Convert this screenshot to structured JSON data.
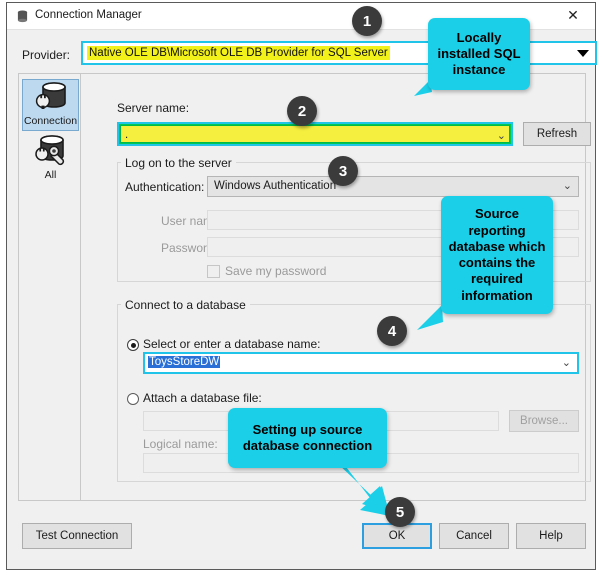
{
  "window": {
    "title": "Connection Manager",
    "close_label": "✕",
    "icon": "database-icon"
  },
  "provider": {
    "label": "Provider:",
    "value": "Native OLE DB\\Microsoft OLE DB Provider for SQL Server",
    "highlight_color": "#f3f11a",
    "focus_color": "#1fc4e8"
  },
  "sidebar": {
    "items": [
      {
        "label": "Connection",
        "icon": "database-plug-icon",
        "selected": true
      },
      {
        "label": "All",
        "icon": "database-wrench-icon",
        "selected": false
      }
    ]
  },
  "server": {
    "label": "Server name:",
    "value": ".",
    "chevron": "⌄",
    "refresh_label": "Refresh",
    "fill_color": "#f5ef3f",
    "inner_border_color": "#00b84a",
    "outer_border_color": "#1fc4e8"
  },
  "logon": {
    "group_title": "Log on to the server",
    "auth_label": "Authentication:",
    "auth_value": "Windows Authentication",
    "auth_chevron": "⌄",
    "username_label": "User name:",
    "username_value": "",
    "password_label": "Password:",
    "password_value": "",
    "save_password_label": "Save my password",
    "save_password_checked": false
  },
  "database": {
    "group_title": "Connect to a database",
    "select_radio_label": "Select or enter a database name:",
    "select_radio_checked": true,
    "selected_db": "ToysStoreDW",
    "db_chevron": "⌄",
    "attach_radio_label": "Attach a database file:",
    "attach_radio_checked": false,
    "attach_file_value": "",
    "browse_label": "Browse...",
    "logical_name_label": "Logical name:",
    "logical_name_value": ""
  },
  "footer": {
    "test_connection_label": "Test Connection",
    "ok_label": "OK",
    "cancel_label": "Cancel",
    "help_label": "Help"
  },
  "annotations": {
    "accent_color": "#1ccfe8",
    "badge_color": "#3b3b3b",
    "badges": [
      {
        "number": "1"
      },
      {
        "number": "2"
      },
      {
        "number": "3"
      },
      {
        "number": "4"
      },
      {
        "number": "5"
      }
    ],
    "callouts": [
      {
        "text": "Locally installed SQL instance"
      },
      {
        "text": "Source reporting database which contains the required information"
      },
      {
        "text": "Setting up source database connection"
      }
    ]
  }
}
